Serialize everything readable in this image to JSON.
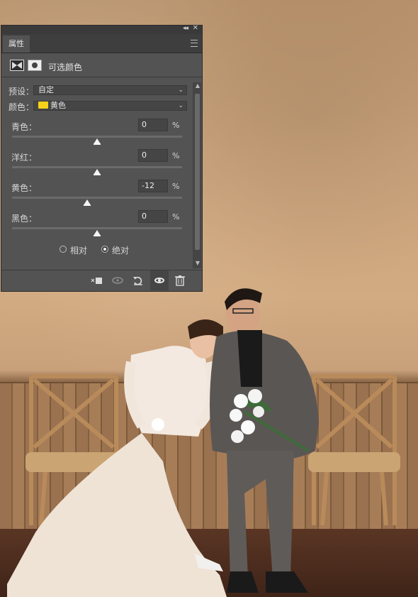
{
  "panel": {
    "tab_label": "属性",
    "title": "可选颜色",
    "preset_label": "预设：",
    "preset_value": "自定",
    "colors_label": "颜色：",
    "colors_value": "黄色",
    "colors_swatch": "#f7d117",
    "sliders": [
      {
        "label": "青色：",
        "value": "0",
        "unit": "%",
        "level": 0
      },
      {
        "label": "洋红：",
        "value": "0",
        "unit": "%",
        "level": 0
      },
      {
        "label": "黄色：",
        "value": "-12",
        "unit": "%",
        "level": -12
      },
      {
        "label": "黑色：",
        "value": "0",
        "unit": "%",
        "level": 0
      }
    ],
    "method": {
      "relative_label": "相对",
      "absolute_label": "绝对",
      "selected": "absolute"
    }
  },
  "footer_icons": [
    "clip-to-layer-icon",
    "view-previous-state-icon",
    "reset-icon",
    "visibility-eye-icon",
    "trash-icon"
  ]
}
